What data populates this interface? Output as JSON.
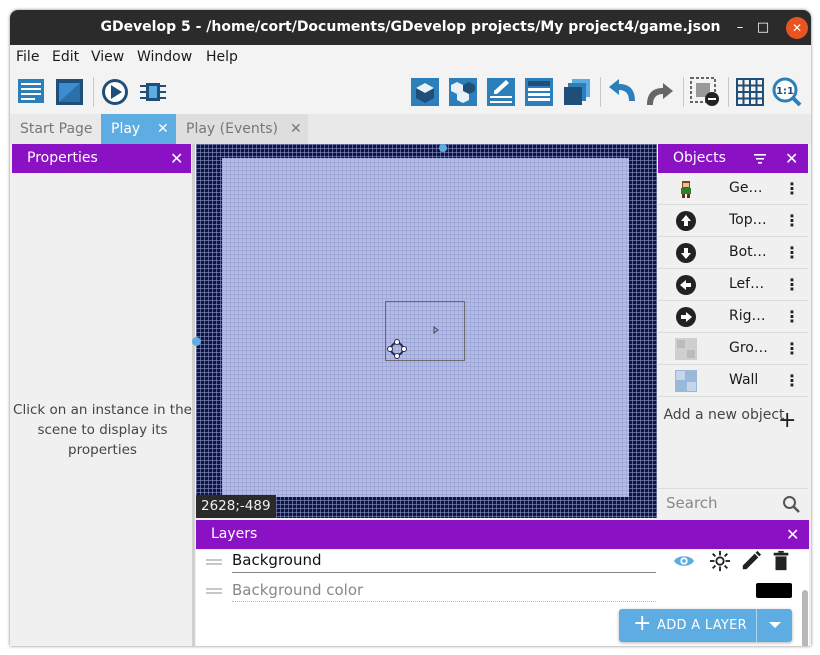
{
  "window": {
    "title": "GDevelop 5 - /home/cort/Documents/GDevelop projects/My project4/game.json"
  },
  "window_controls": {
    "minimize": "–",
    "maximize": "□",
    "close": "✕"
  },
  "menu": [
    "File",
    "Edit",
    "View",
    "Window",
    "Help"
  ],
  "toolbar": {
    "left_tools": [
      "project-manager-icon",
      "scene-editor-icon",
      "preview-play-icon",
      "debugger-icon"
    ],
    "right_tools": [
      "objects-panel-icon",
      "object-groups-icon",
      "properties-panel-icon",
      "instances-list-icon",
      "layers-panel-icon",
      "undo-icon",
      "redo-icon",
      "grid-settings-icon",
      "toggle-grid-icon",
      "zoom-reset-icon"
    ]
  },
  "tabs": [
    {
      "label": "Start Page",
      "active": false
    },
    {
      "label": "Play",
      "active": true,
      "close": "✕"
    },
    {
      "label": "Play (Events)",
      "active": false,
      "close": "✕"
    }
  ],
  "properties": {
    "title": "Properties",
    "close": "✕",
    "empty_message": "Click on an instance in the scene to display its properties"
  },
  "scene": {
    "coordinates": "2628;-489"
  },
  "objects": {
    "title": "Objects",
    "close": "✕",
    "items": [
      {
        "name": "Ge…",
        "icon": "character-sprite-icon"
      },
      {
        "name": "Top…",
        "icon": "arrow-up-circle-icon"
      },
      {
        "name": "Bot…",
        "icon": "arrow-down-circle-icon"
      },
      {
        "name": "Lef…",
        "icon": "arrow-left-circle-icon"
      },
      {
        "name": "Rig…",
        "icon": "arrow-right-circle-icon"
      },
      {
        "name": "Gro…",
        "icon": "ground-tile-icon"
      },
      {
        "name": "Wall",
        "icon": "wall-tile-icon"
      }
    ],
    "add_new_label": "Add a new object",
    "add_icon": "+",
    "search_placeholder": "Search"
  },
  "layers": {
    "title": "Layers",
    "close": "✕",
    "items": [
      {
        "name": "Background"
      }
    ],
    "background_color_label": "Background color",
    "background_color": "#000000",
    "add_button_label": "ADD A LAYER",
    "add_icon": "+"
  },
  "colors": {
    "accent_purple": "#8b11c5",
    "tab_blue": "#5dade2",
    "close_orange": "#e95420"
  }
}
